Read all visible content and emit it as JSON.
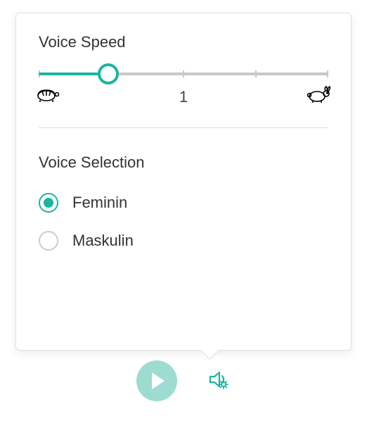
{
  "voiceSpeed": {
    "title": "Voice Speed",
    "value": "1",
    "sliderPercent": 24
  },
  "voiceSelection": {
    "title": "Voice Selection",
    "options": [
      {
        "label": "Feminin",
        "selected": true
      },
      {
        "label": "Maskulin",
        "selected": false
      }
    ]
  },
  "colors": {
    "accent": "#1bb5a0",
    "accentLight": "#9edbd0"
  }
}
